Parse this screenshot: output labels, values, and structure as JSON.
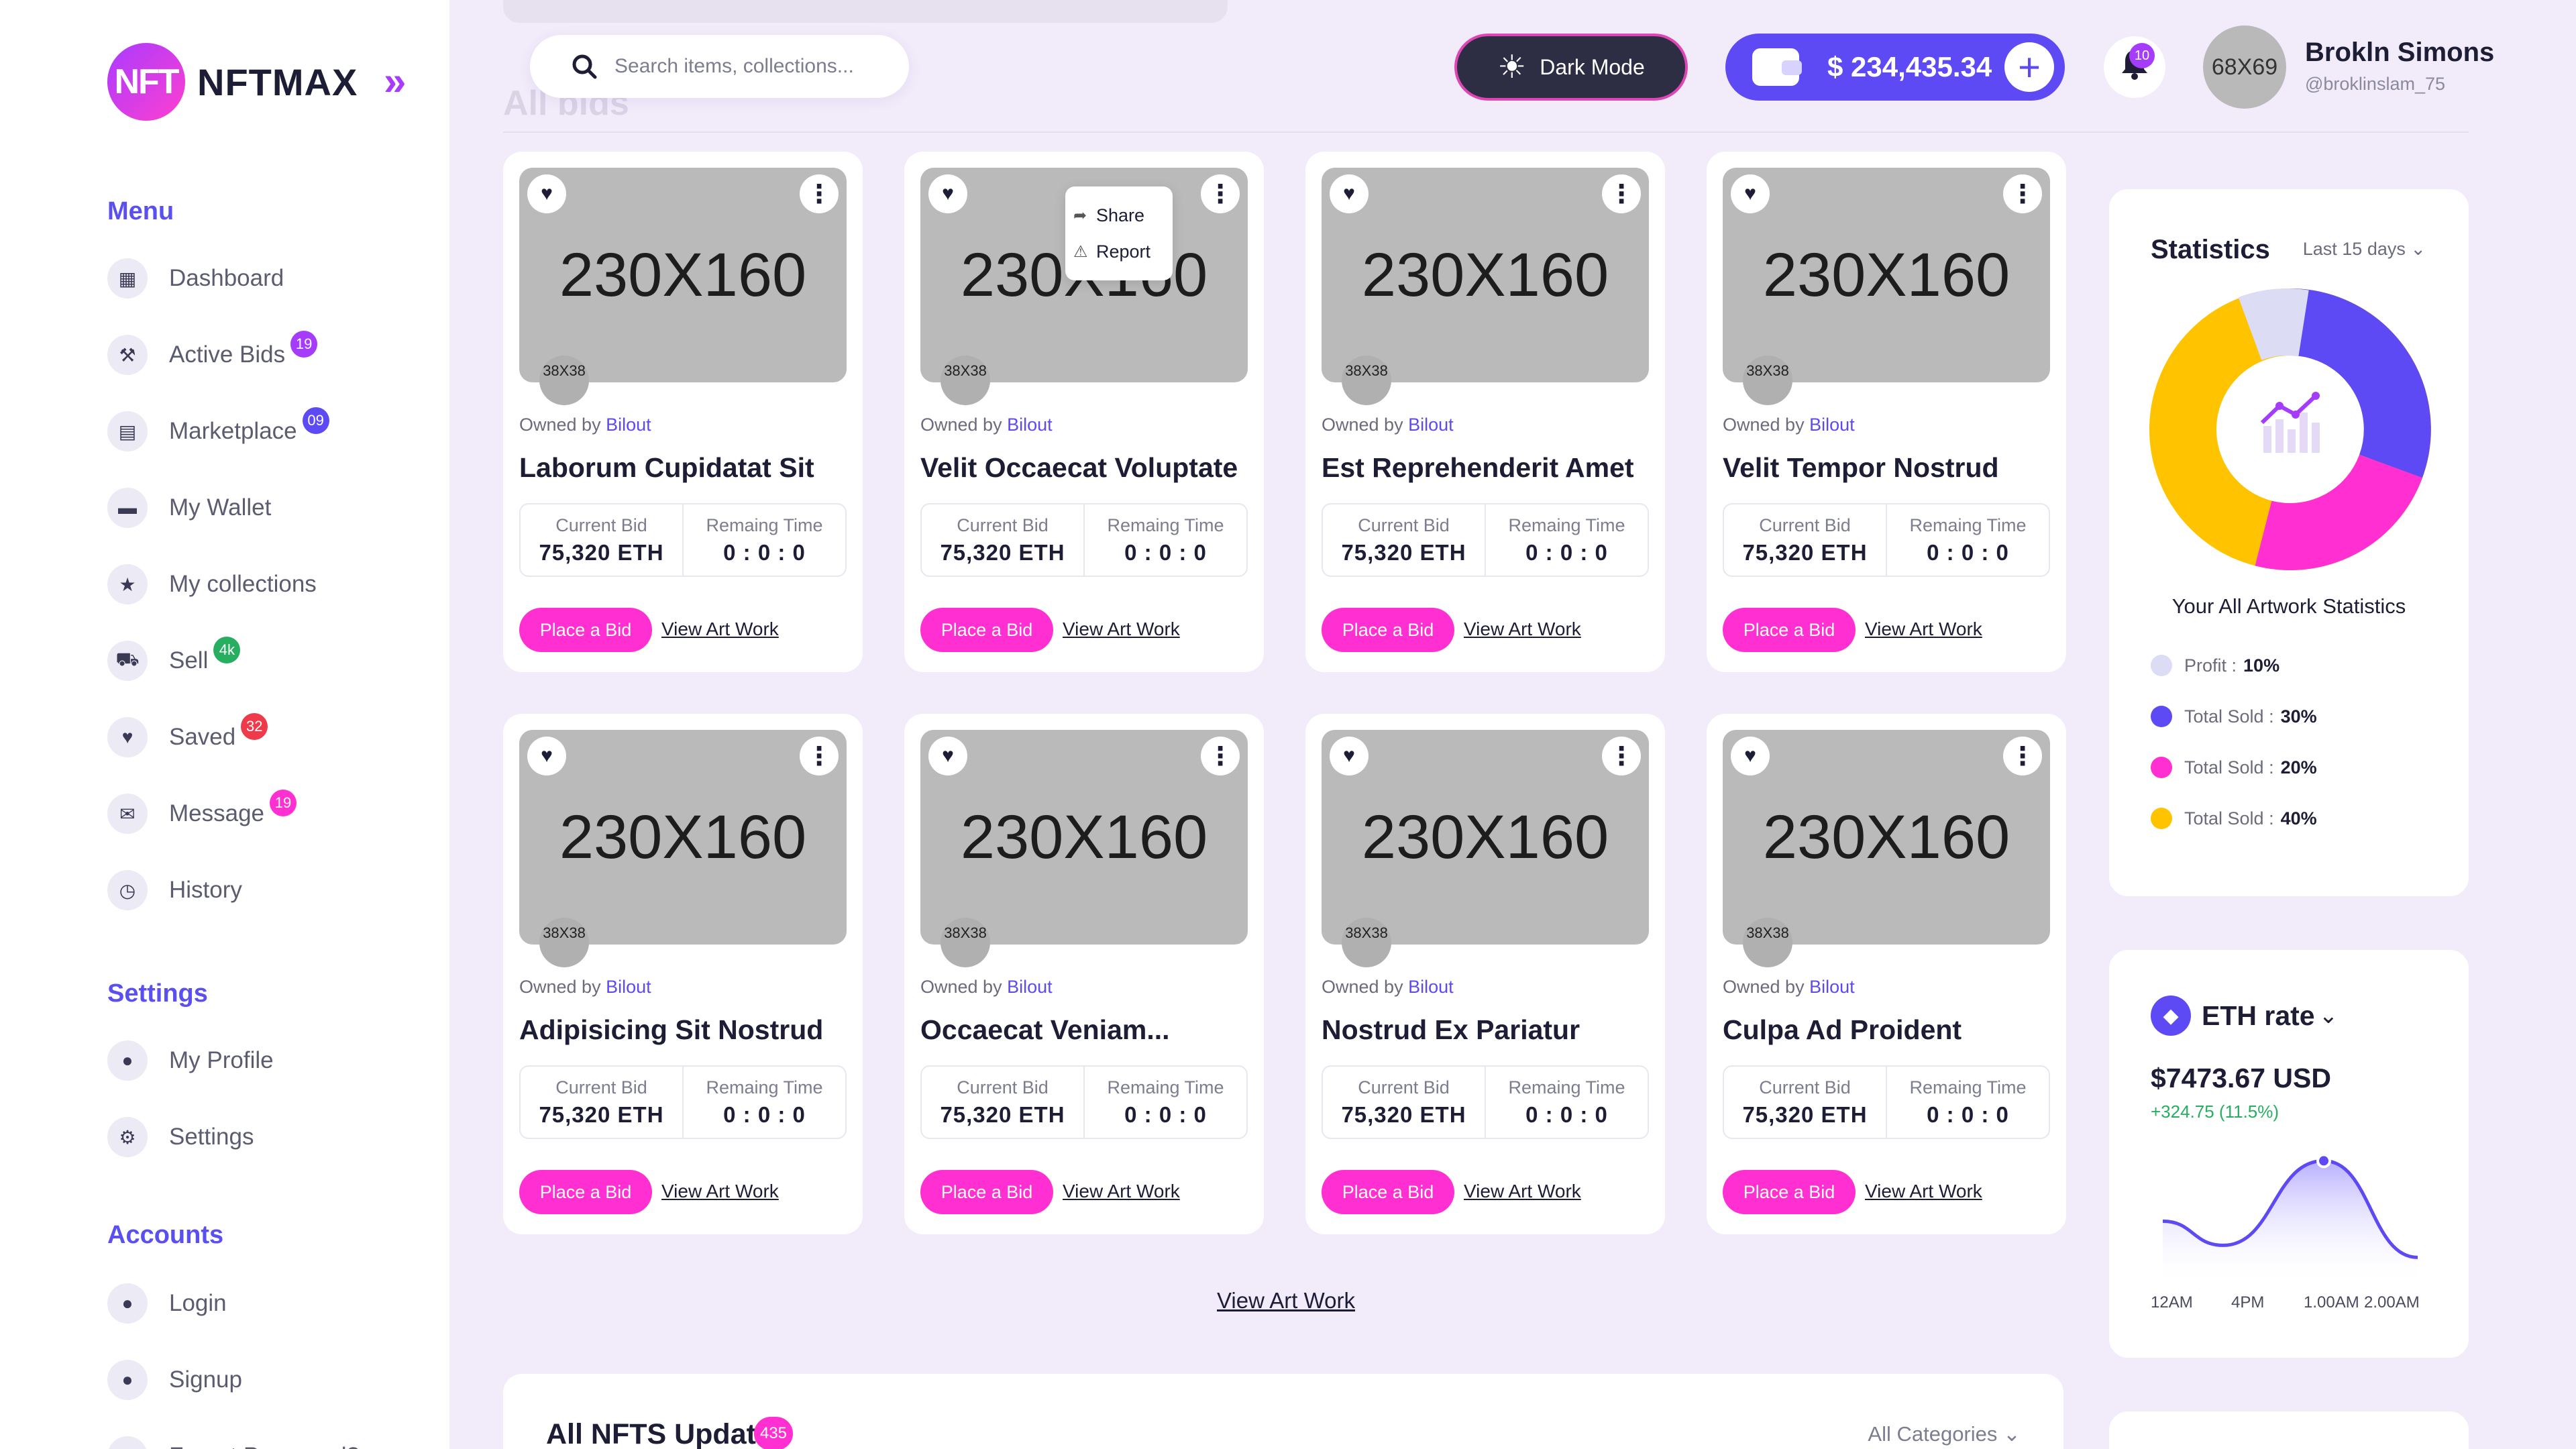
{
  "brand": {
    "logo_initials": "NFT",
    "name": "NFTMAX",
    "collapse_glyph": "»"
  },
  "sidebar": {
    "menu_title": "Menu",
    "menu": [
      {
        "label": "Dashboard",
        "icon": "grid-icon",
        "badge": null
      },
      {
        "label": "Active Bids",
        "icon": "gavel-icon",
        "badge": "19",
        "badge_color": "#a53cfb"
      },
      {
        "label": "Marketplace",
        "icon": "store-icon",
        "badge": "09",
        "badge_color": "#5e4af5"
      },
      {
        "label": "My Wallet",
        "icon": "wallet-icon",
        "badge": null
      },
      {
        "label": "My collections",
        "icon": "star-icon",
        "badge": null
      },
      {
        "label": "Sell",
        "icon": "cart-icon",
        "badge": "4k",
        "badge_color": "#27ae60"
      },
      {
        "label": "Saved",
        "icon": "heart-icon",
        "badge": "32",
        "badge_color": "#ee3a4a"
      },
      {
        "label": "Message",
        "icon": "mail-icon",
        "badge": "19",
        "badge_color": "#ff2fd1"
      },
      {
        "label": "History",
        "icon": "clock-icon",
        "badge": null
      }
    ],
    "settings_title": "Settings",
    "settings": [
      {
        "label": "My Profile",
        "icon": "user-icon"
      },
      {
        "label": "Settings",
        "icon": "gear-icon"
      }
    ],
    "accounts_title": "Accounts",
    "accounts": [
      {
        "label": "Login",
        "icon": "user-icon"
      },
      {
        "label": "Signup",
        "icon": "user-icon"
      },
      {
        "label": "Forget Password?",
        "icon": "user-icon"
      }
    ]
  },
  "header": {
    "search_placeholder": "Search items, collections...",
    "dark_mode_label": "Dark Mode",
    "wallet_balance": "$ 234,435.34",
    "wallet_add": "+",
    "notifications_count": "10",
    "user": {
      "avatar_text": "68X69",
      "name": "Brokln Simons",
      "handle": "@broklinslam_75"
    }
  },
  "ghost_title": "All bids",
  "cards": [
    {
      "image": "230X160",
      "owner_avatar": "38X38",
      "owner_prefix": "Owned by",
      "owner": "Bilout",
      "title": "Laborum Cupidatat Sit",
      "bid_label": "Current Bid",
      "bid": "75,320 ETH",
      "time_label": "Remaing Time",
      "time": "0 : 0 : 0",
      "place_bid": "Place a Bid",
      "view": "View Art Work"
    },
    {
      "image": "230X160",
      "owner_avatar": "38X38",
      "owner_prefix": "Owned by",
      "owner": "Bilout",
      "title": "Velit Occaecat Voluptate",
      "bid_label": "Current Bid",
      "bid": "75,320 ETH",
      "time_label": "Remaing Time",
      "time": "0 : 0 : 0",
      "place_bid": "Place a Bid",
      "view": "View Art Work"
    },
    {
      "image": "230X160",
      "owner_avatar": "38X38",
      "owner_prefix": "Owned by",
      "owner": "Bilout",
      "title": "Est Reprehenderit Amet",
      "bid_label": "Current Bid",
      "bid": "75,320 ETH",
      "time_label": "Remaing Time",
      "time": "0 : 0 : 0",
      "place_bid": "Place a Bid",
      "view": "View Art Work"
    },
    {
      "image": "230X160",
      "owner_avatar": "38X38",
      "owner_prefix": "Owned by",
      "owner": "Bilout",
      "title": "Velit Tempor Nostrud",
      "bid_label": "Current Bid",
      "bid": "75,320 ETH",
      "time_label": "Remaing Time",
      "time": "0 : 0 : 0",
      "place_bid": "Place a Bid",
      "view": "View Art Work"
    },
    {
      "image": "230X160",
      "owner_avatar": "38X38",
      "owner_prefix": "Owned by",
      "owner": "Bilout",
      "title": "Adipisicing Sit Nostrud",
      "bid_label": "Current Bid",
      "bid": "75,320 ETH",
      "time_label": "Remaing Time",
      "time": "0 : 0 : 0",
      "place_bid": "Place a Bid",
      "view": "View Art Work"
    },
    {
      "image": "230X160",
      "owner_avatar": "38X38",
      "owner_prefix": "Owned by",
      "owner": "Bilout",
      "title": "Occaecat Veniam...",
      "bid_label": "Current Bid",
      "bid": "75,320 ETH",
      "time_label": "Remaing Time",
      "time": "0 : 0 : 0",
      "place_bid": "Place a Bid",
      "view": "View Art Work"
    },
    {
      "image": "230X160",
      "owner_avatar": "38X38",
      "owner_prefix": "Owned by",
      "owner": "Bilout",
      "title": "Nostrud Ex Pariatur",
      "bid_label": "Current Bid",
      "bid": "75,320 ETH",
      "time_label": "Remaing Time",
      "time": "0 : 0 : 0",
      "place_bid": "Place a Bid",
      "view": "View Art Work"
    },
    {
      "image": "230X160",
      "owner_avatar": "38X38",
      "owner_prefix": "Owned by",
      "owner": "Bilout",
      "title": "Culpa Ad Proident",
      "bid_label": "Current Bid",
      "bid": "75,320 ETH",
      "time_label": "Remaing Time",
      "time": "0 : 0 : 0",
      "place_bid": "Place a Bid",
      "view": "View Art Work"
    }
  ],
  "card_menu": {
    "share": "Share",
    "report": "Report"
  },
  "view_all_label": "View Art Work",
  "updates": {
    "title": "All NFTS Update",
    "count": "435",
    "category": "All Categories"
  },
  "statistics": {
    "title": "Statistics",
    "period": "Last 15 days",
    "subtitle": "Your All Artwork Statistics",
    "legend": [
      {
        "label": "Profit :",
        "value": "10%",
        "color": "#dcdcf4"
      },
      {
        "label": "Total Sold :",
        "value": "30%",
        "color": "#5e4af5"
      },
      {
        "label": "Total Sold :",
        "value": "20%",
        "color": "#ff2fd1"
      },
      {
        "label": "Total Sold :",
        "value": "40%",
        "color": "#ffc300"
      }
    ]
  },
  "eth_rate": {
    "label": "ETH rate",
    "price": "$7473.67 USD",
    "change": "+324.75 (11.5%)",
    "x_ticks": [
      "12AM",
      "4PM",
      "1.00AM",
      "2.00AM"
    ]
  },
  "chart_data": {
    "type": "area",
    "title": "ETH rate",
    "x": [
      "12AM",
      "4PM",
      "1.00AM",
      "2.00AM"
    ],
    "series": [
      {
        "values": [
          0.42,
          0.22,
          0.92,
          0.12
        ]
      }
    ],
    "xlabel": "",
    "ylabel": ""
  },
  "colors": {
    "accent": "#5e4af5",
    "pink": "#ff2fd1",
    "yellow": "#ffc300",
    "dark": "#2d2e43"
  }
}
